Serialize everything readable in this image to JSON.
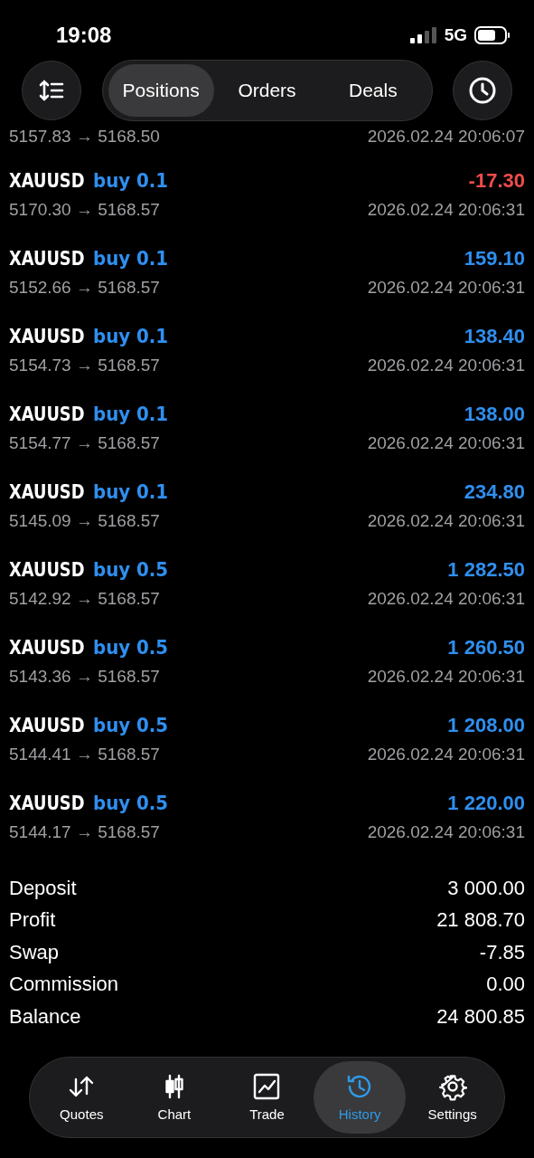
{
  "status_bar": {
    "time": "19:08",
    "network": "5G"
  },
  "segments": [
    {
      "label": "Positions",
      "selected": true
    },
    {
      "label": "Orders",
      "selected": false
    },
    {
      "label": "Deals",
      "selected": false
    }
  ],
  "partial_deal": {
    "prices": "5157.83 → 5168.50",
    "time": "2026.02.24 20:06:07"
  },
  "deals": [
    {
      "symbol": "XAUUSD",
      "side": "buy 0.1",
      "profit": "-17.30",
      "loss": true,
      "prices": "5170.30 → 5168.57",
      "time": "2026.02.24 20:06:31"
    },
    {
      "symbol": "XAUUSD",
      "side": "buy 0.1",
      "profit": "159.10",
      "loss": false,
      "prices": "5152.66 → 5168.57",
      "time": "2026.02.24 20:06:31"
    },
    {
      "symbol": "XAUUSD",
      "side": "buy 0.1",
      "profit": "138.40",
      "loss": false,
      "prices": "5154.73 → 5168.57",
      "time": "2026.02.24 20:06:31"
    },
    {
      "symbol": "XAUUSD",
      "side": "buy 0.1",
      "profit": "138.00",
      "loss": false,
      "prices": "5154.77 → 5168.57",
      "time": "2026.02.24 20:06:31"
    },
    {
      "symbol": "XAUUSD",
      "side": "buy 0.1",
      "profit": "234.80",
      "loss": false,
      "prices": "5145.09 → 5168.57",
      "time": "2026.02.24 20:06:31"
    },
    {
      "symbol": "XAUUSD",
      "side": "buy 0.5",
      "profit": "1 282.50",
      "loss": false,
      "prices": "5142.92 → 5168.57",
      "time": "2026.02.24 20:06:31"
    },
    {
      "symbol": "XAUUSD",
      "side": "buy 0.5",
      "profit": "1 260.50",
      "loss": false,
      "prices": "5143.36 → 5168.57",
      "time": "2026.02.24 20:06:31"
    },
    {
      "symbol": "XAUUSD",
      "side": "buy 0.5",
      "profit": "1 208.00",
      "loss": false,
      "prices": "5144.41 → 5168.57",
      "time": "2026.02.24 20:06:31"
    },
    {
      "symbol": "XAUUSD",
      "side": "buy 0.5",
      "profit": "1 220.00",
      "loss": false,
      "prices": "5144.17 → 5168.57",
      "time": "2026.02.24 20:06:31"
    }
  ],
  "summary": [
    {
      "label": "Deposit",
      "value": "3 000.00"
    },
    {
      "label": "Profit",
      "value": "21 808.70"
    },
    {
      "label": "Swap",
      "value": "-7.85"
    },
    {
      "label": "Commission",
      "value": "0.00"
    },
    {
      "label": "Balance",
      "value": "24 800.85"
    }
  ],
  "tab_bar": [
    {
      "kind": "quotes",
      "label": "Quotes",
      "selected": false
    },
    {
      "kind": "chart",
      "label": "Chart",
      "selected": false
    },
    {
      "kind": "trade",
      "label": "Trade",
      "selected": false
    },
    {
      "kind": "history",
      "label": "History",
      "selected": true
    },
    {
      "kind": "settings",
      "label": "Settings",
      "selected": false
    }
  ]
}
